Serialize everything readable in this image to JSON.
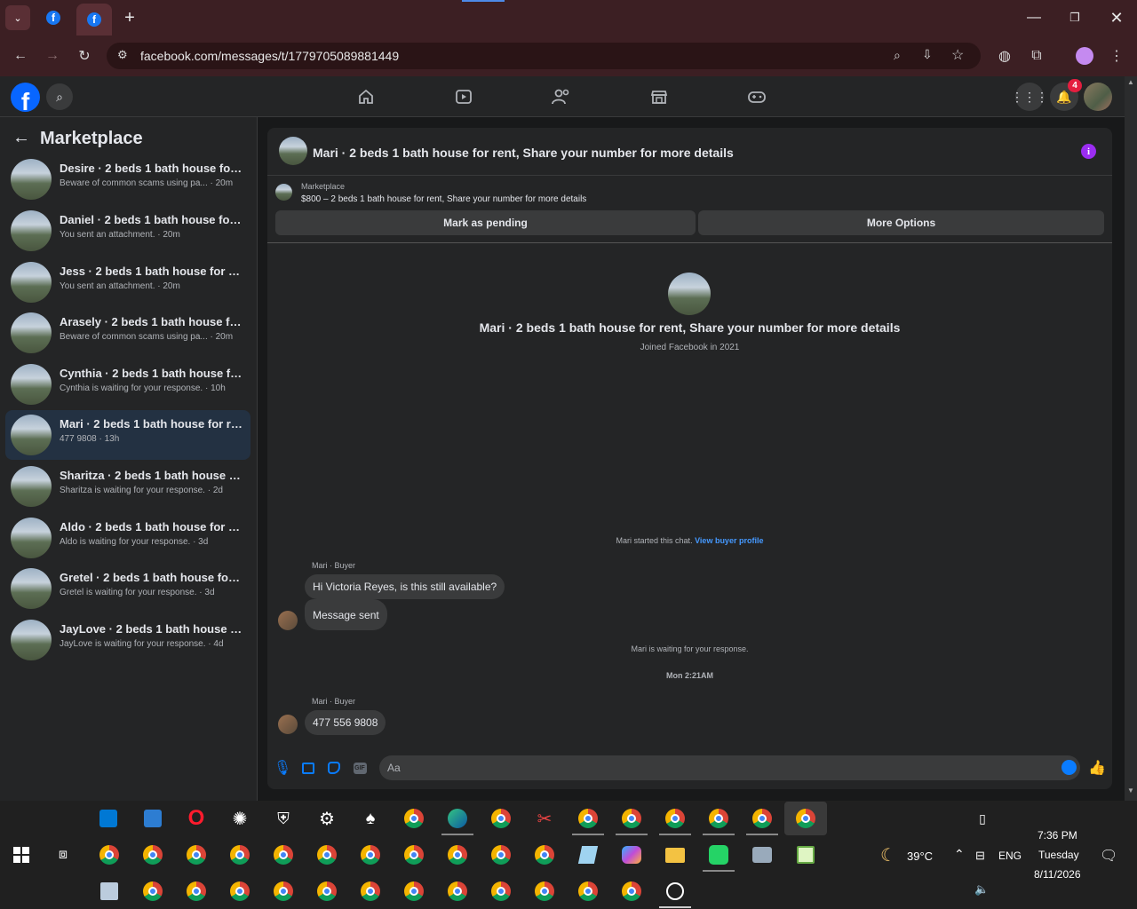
{
  "browser": {
    "url": "facebook.com/messages/t/1779705089881449"
  },
  "fb": {
    "notif_count": "4"
  },
  "sidebar": {
    "title": "Marketplace",
    "conversations": [
      {
        "title": "Desire · 2 beds 1 bath house for re...",
        "sub": "Beware of common scams using pa... · 20m"
      },
      {
        "title": "Daniel · 2 beds 1 bath house for re...",
        "sub": "You sent an attachment. · 20m"
      },
      {
        "title": "Jess · 2 beds 1 bath house for rent,...",
        "sub": "You sent an attachment. · 20m"
      },
      {
        "title": "Arasely · 2 beds 1 bath house for r...",
        "sub": "Beware of common scams using pa... · 20m"
      },
      {
        "title": "Cynthia · 2 beds 1 bath house for r...",
        "sub": "Cynthia is waiting for your response. · 10h"
      },
      {
        "title": "Mari · 2 beds 1 bath house for rent...",
        "sub": "477 9808 · 13h"
      },
      {
        "title": "Sharitza · 2 beds 1 bath house for r...",
        "sub": "Sharitza is waiting for your response. · 2d"
      },
      {
        "title": "Aldo · 2 beds 1 bath house for rent...",
        "sub": "Aldo is waiting for your response. · 3d"
      },
      {
        "title": "Gretel · 2 beds 1 bath house for re...",
        "sub": "Gretel is waiting for your response. · 3d"
      },
      {
        "title": "JayLove · 2 beds 1 bath house for r...",
        "sub": "JayLove is waiting for your response. · 4d"
      }
    ]
  },
  "chat": {
    "header_title": "Mari · 2 beds 1 bath house for rent, Share your number for more details",
    "listing_label": "Marketplace",
    "listing_detail": "$800 – 2 beds 1 bath house for rent, Share your number for more details",
    "mark_pending": "Mark as pending",
    "more_options": "More Options",
    "profile_title": "Mari · 2 beds 1 bath house for rent, Share your number for more details",
    "joined": "Joined Facebook in 2021",
    "started_text": "Mari started this chat.",
    "view_buyer": "View buyer profile",
    "sender1": "Mari · Buyer",
    "msg1": "Hi Victoria Reyes, is this still available?",
    "msg2": "Message sent",
    "waiting": "Mari is waiting for your response.",
    "timestamp": "Mon 2:21AM",
    "sender2": "Mari · Buyer",
    "msg3": "477 556 9808",
    "composer_placeholder": "Aa"
  },
  "taskbar": {
    "weather": "39°C",
    "lang": "ENG",
    "time": "7:36 PM",
    "day": "Tuesday",
    "date": "8/11/2026"
  }
}
